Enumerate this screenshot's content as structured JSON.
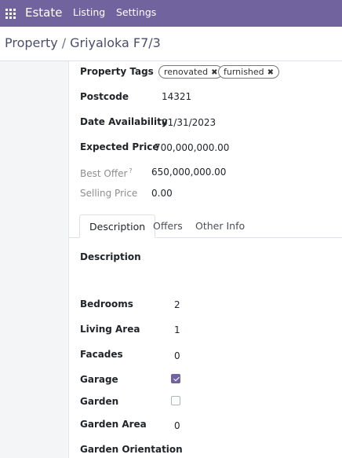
{
  "navbar": {
    "app_name": "Estate",
    "menu": [
      "Listing",
      "Settings"
    ]
  },
  "breadcrumb": {
    "parent": "Property",
    "separator": "/",
    "current": "Griyaloka F7/3"
  },
  "fields": {
    "property_tags": {
      "label": "Property Tags",
      "tags": [
        "renovated",
        "furnished"
      ]
    },
    "postcode": {
      "label": "Postcode",
      "value": "14321"
    },
    "date_availability": {
      "label": "Date Availability",
      "value": "01/31/2023"
    },
    "expected_price": {
      "label": "Expected Price",
      "value": "700,000,000.00"
    },
    "best_offer": {
      "label": "Best Offer",
      "help": "?",
      "value": "650,000,000.00"
    },
    "selling_price": {
      "label": "Selling Price",
      "value": "0.00"
    }
  },
  "tabs": [
    {
      "label": "Description",
      "active": true
    },
    {
      "label": "Offers",
      "active": false
    },
    {
      "label": "Other Info",
      "active": false
    }
  ],
  "description_tab": {
    "description": {
      "label": "Description",
      "value": ""
    },
    "bedrooms": {
      "label": "Bedrooms",
      "value": "2"
    },
    "living_area": {
      "label": "Living Area",
      "value": "1"
    },
    "facades": {
      "label": "Facades",
      "value": "0"
    },
    "garage": {
      "label": "Garage",
      "checked": true
    },
    "garden": {
      "label": "Garden",
      "checked": false
    },
    "garden_area": {
      "label": "Garden Area",
      "value": "0"
    },
    "garden_orientation": {
      "label": "Garden Orientation",
      "value": ""
    }
  },
  "colors": {
    "brand": "#71639e",
    "text": "#212529",
    "muted": "#8d8d8d"
  }
}
